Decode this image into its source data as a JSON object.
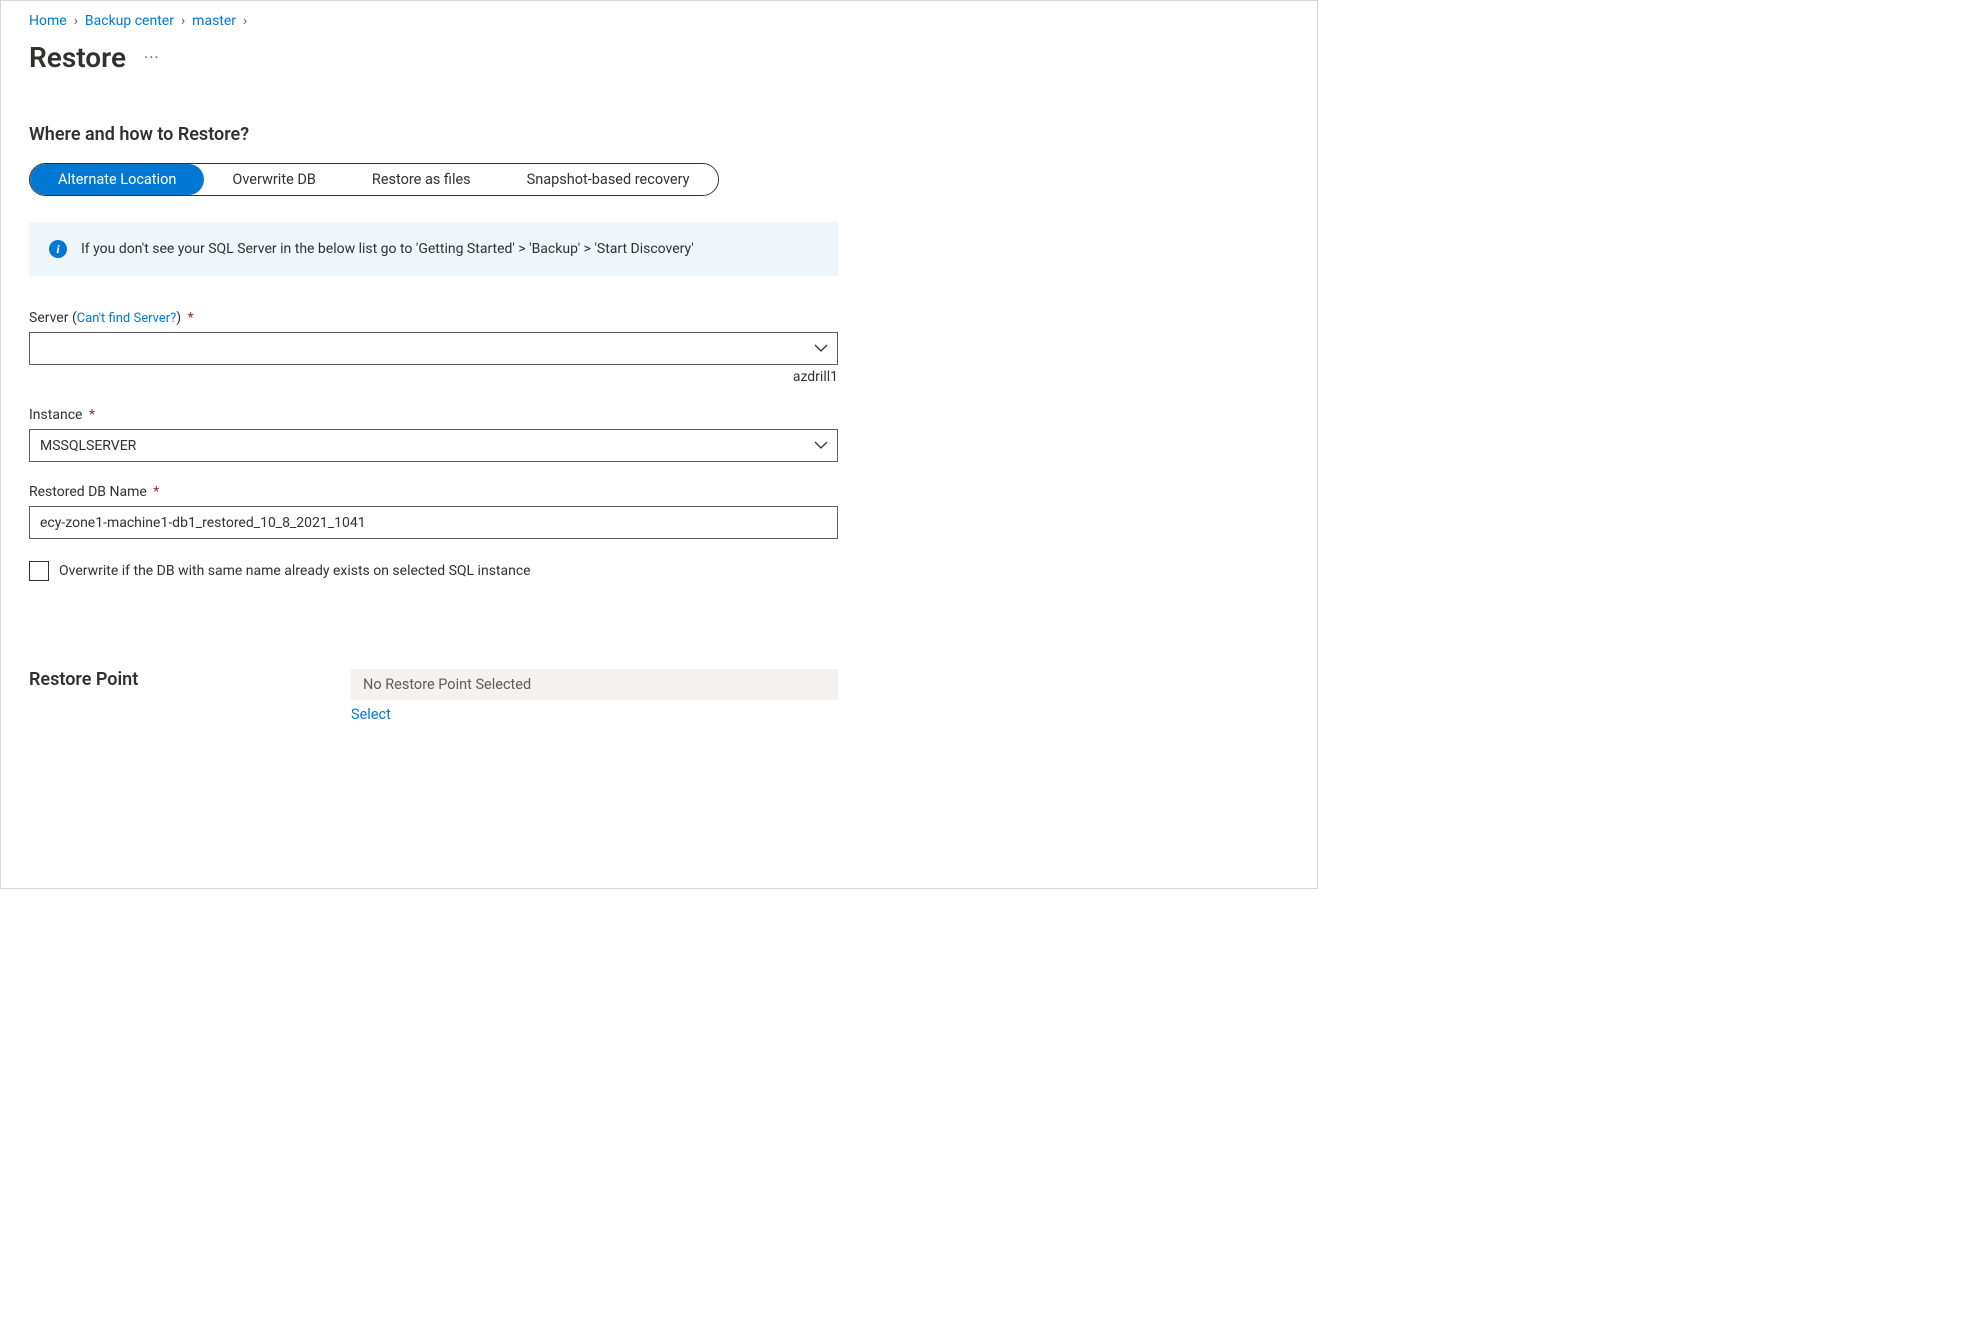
{
  "breadcrumb": {
    "items": [
      {
        "label": "Home"
      },
      {
        "label": "Backup center"
      },
      {
        "label": "master"
      }
    ]
  },
  "page": {
    "title": "Restore"
  },
  "section1": {
    "heading": "Where and how to Restore?",
    "options": [
      {
        "label": "Alternate Location",
        "selected": true
      },
      {
        "label": "Overwrite DB",
        "selected": false
      },
      {
        "label": "Restore as files",
        "selected": false
      },
      {
        "label": "Snapshot-based recovery",
        "selected": false
      }
    ]
  },
  "info": {
    "text": "If you don't see your SQL Server in the below list go to 'Getting Started' > 'Backup' > 'Start Discovery'"
  },
  "form": {
    "server": {
      "label": "Server",
      "hint_link": "Can't find Server?",
      "value": "",
      "helper": "azdrill1"
    },
    "instance": {
      "label": "Instance",
      "value": "MSSQLSERVER"
    },
    "restored_db": {
      "label": "Restored DB Name",
      "value": "ecy-zone1-machine1-db1_restored_10_8_2021_1041"
    },
    "overwrite_checkbox": {
      "label": "Overwrite if the DB with same name already exists on selected SQL instance",
      "checked": false
    }
  },
  "restore_point": {
    "heading": "Restore Point",
    "value": "No Restore Point Selected",
    "select_label": "Select"
  }
}
